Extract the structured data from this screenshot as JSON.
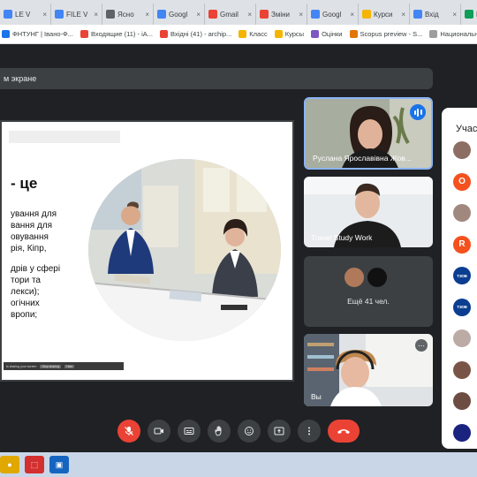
{
  "browser": {
    "tabs": [
      {
        "label": "LE V",
        "favicon_color": "#4285f4"
      },
      {
        "label": "FILE V",
        "favicon_color": "#4285f4"
      },
      {
        "label": "Ясно",
        "favicon_color": "#5f6368"
      },
      {
        "label": "Googl",
        "favicon_color": "#4285f4"
      },
      {
        "label": "Gmail",
        "favicon_color": "#ea4335"
      },
      {
        "label": "Зміни",
        "favicon_color": "#ea4335"
      },
      {
        "label": "Googl",
        "favicon_color": "#4285f4"
      },
      {
        "label": "Курси",
        "favicon_color": "#f4b400"
      },
      {
        "label": "Вхід",
        "favicon_color": "#4285f4"
      },
      {
        "label": "KATA",
        "favicon_color": "#0f9d58"
      }
    ],
    "bookmarks": [
      {
        "label": "ФНТУНГ | Івано-Ф...",
        "favicon_color": "#1a73e8"
      },
      {
        "label": "Входящие (11) - iA...",
        "favicon_color": "#ea4335"
      },
      {
        "label": "Вхідні (41) - archip...",
        "favicon_color": "#ea4335"
      },
      {
        "label": "Класс",
        "favicon_color": "#f4b400"
      },
      {
        "label": "Курсы",
        "favicon_color": "#f4b400"
      },
      {
        "label": "Оцінки",
        "favicon_color": "#7e57c2"
      },
      {
        "label": "Scopus preview - S...",
        "favicon_color": "#e37400"
      },
      {
        "label": "Национальное аге",
        "favicon_color": "#9e9e9e"
      }
    ]
  },
  "meet": {
    "presenting_bar_label": "м экране",
    "slide": {
      "heading": "- це",
      "body_lines": [
        "ування для",
        "вання для",
        "овування",
        "рія, Кіпр,",
        "",
        "дрів у сфері",
        "тори та",
        "лекси);",
        "огічних",
        "вропи;"
      ],
      "toolbar_text": "Is sharing your screen",
      "toolbar_buttons": [
        "Stop sharing",
        "Hide"
      ]
    },
    "tiles": [
      {
        "name": "Руслана Ярославівна Жов...",
        "speaking": true
      },
      {
        "name": "Travel Study Work",
        "speaking": false
      },
      {
        "name": "Ещё 41 чел.",
        "speaking": false
      },
      {
        "name": "Вы",
        "speaking": false
      }
    ],
    "participants_panel": {
      "title": "Учас",
      "avatars": [
        {
          "kind": "photo",
          "color": "#8d6e63",
          "text": ""
        },
        {
          "kind": "letter",
          "color": "#f4511e",
          "text": "O"
        },
        {
          "kind": "photo",
          "color": "#a1887f",
          "text": ""
        },
        {
          "kind": "letter",
          "color": "#f4511e",
          "text": "R"
        },
        {
          "kind": "logo",
          "color": "#0b3d91",
          "text": "ТЗОВ"
        },
        {
          "kind": "logo",
          "color": "#0b3d91",
          "text": "ТЗОВ"
        },
        {
          "kind": "photo",
          "color": "#bcaaa4",
          "text": ""
        },
        {
          "kind": "photo",
          "color": "#795548",
          "text": ""
        },
        {
          "kind": "photo",
          "color": "#6d4c41",
          "text": ""
        },
        {
          "kind": "photo",
          "color": "#1a237e",
          "text": ""
        }
      ]
    },
    "controls": [
      {
        "name": "microphone-off",
        "icon": "mic-off-icon"
      },
      {
        "name": "camera",
        "icon": "camera-icon"
      },
      {
        "name": "captions",
        "icon": "captions-icon"
      },
      {
        "name": "raise-hand",
        "icon": "hand-icon"
      },
      {
        "name": "emoji",
        "icon": "emoji-icon"
      },
      {
        "name": "present",
        "icon": "present-icon"
      },
      {
        "name": "more",
        "icon": "more-icon"
      },
      {
        "name": "hang-up",
        "icon": "phone-icon"
      }
    ],
    "colors": {
      "background": "#202124",
      "tile": "#3c4043",
      "danger": "#ea4335",
      "speaking": "#1a73e8"
    }
  },
  "taskbar": {
    "apps": [
      {
        "icon": "users-icon",
        "color": "#e0a800"
      },
      {
        "icon": "pdf-icon",
        "color": "#d32f2f"
      },
      {
        "icon": "image-viewer-icon",
        "color": "#1565c0"
      }
    ]
  }
}
